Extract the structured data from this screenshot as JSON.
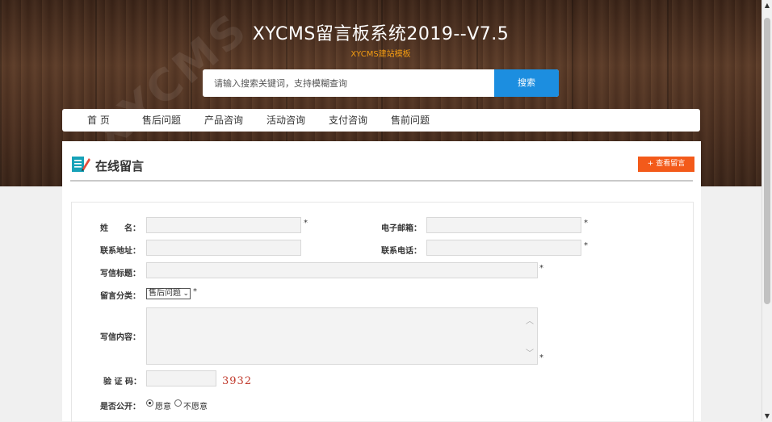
{
  "header": {
    "title": "XYCMS留言板系统2019--V7.5",
    "subtitle": "XYCMS建站模板",
    "watermark": "XYCMS"
  },
  "search": {
    "placeholder": "请输入搜索关键词，支持模糊查询",
    "button_label": "搜索"
  },
  "nav": {
    "items": [
      {
        "label": "首  页"
      },
      {
        "label": "售后问题"
      },
      {
        "label": "产品咨询"
      },
      {
        "label": "活动咨询"
      },
      {
        "label": "支付咨询"
      },
      {
        "label": "售前问题"
      }
    ]
  },
  "panel": {
    "title": "在线留言",
    "view_button": "+ 查看留言"
  },
  "form": {
    "name_label": "姓　　名：",
    "email_label": "电子邮箱：",
    "address_label": "联系地址：",
    "phone_label": "联系电话：",
    "subject_label": "写信标题：",
    "category_label": "留言分类：",
    "category_value": "售后问题",
    "content_label": "写信内容：",
    "captcha_label": "验 证 码：",
    "captcha_code": "3932",
    "public_label": "是否公开：",
    "public_options": [
      {
        "label": "愿意",
        "selected": true
      },
      {
        "label": "不愿意",
        "selected": false
      }
    ],
    "required_mark": "*"
  },
  "colors": {
    "search_button": "#1c8ee0",
    "view_button": "#f35a1a",
    "subtitle": "#f39c12",
    "captcha": "#c0392b"
  }
}
